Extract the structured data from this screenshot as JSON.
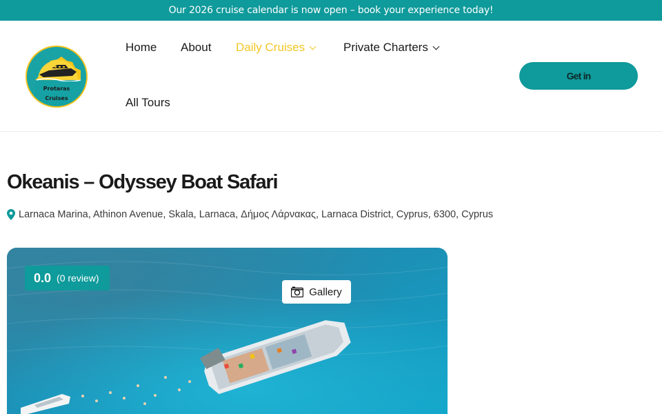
{
  "announcement": {
    "text": "Our 2026 cruise calendar is now open – book your experience today!"
  },
  "logo": {
    "line1": "Protaras",
    "line2": "Cruises"
  },
  "nav": {
    "items": [
      {
        "label": "Home",
        "active": false,
        "has_dropdown": false
      },
      {
        "label": "About",
        "active": false,
        "has_dropdown": false
      },
      {
        "label": "Daily Cruises",
        "active": true,
        "has_dropdown": true
      },
      {
        "label": "Private Charters",
        "active": false,
        "has_dropdown": true
      },
      {
        "label": "All Tours",
        "active": false,
        "has_dropdown": false
      }
    ]
  },
  "cta": {
    "label": "Get in"
  },
  "tour": {
    "title": "Okeanis – Odyssey Boat Safari",
    "address": "Larnaca Marina, Athinon Avenue, Skala, Larnaca, Δήμος Λάρνακας, Larnaca District, Cyprus, 6300, Cyprus"
  },
  "rating": {
    "score": "0.0",
    "reviews": "(0 review)"
  },
  "gallery": {
    "label": "Gallery"
  },
  "colors": {
    "brand": "#0f9a9b",
    "accent": "#f2c624",
    "text": "#1a1a1a"
  },
  "icons": {
    "location": "map-pin-icon",
    "gallery": "camera-icon",
    "dropdown": "chevron-down-icon"
  }
}
